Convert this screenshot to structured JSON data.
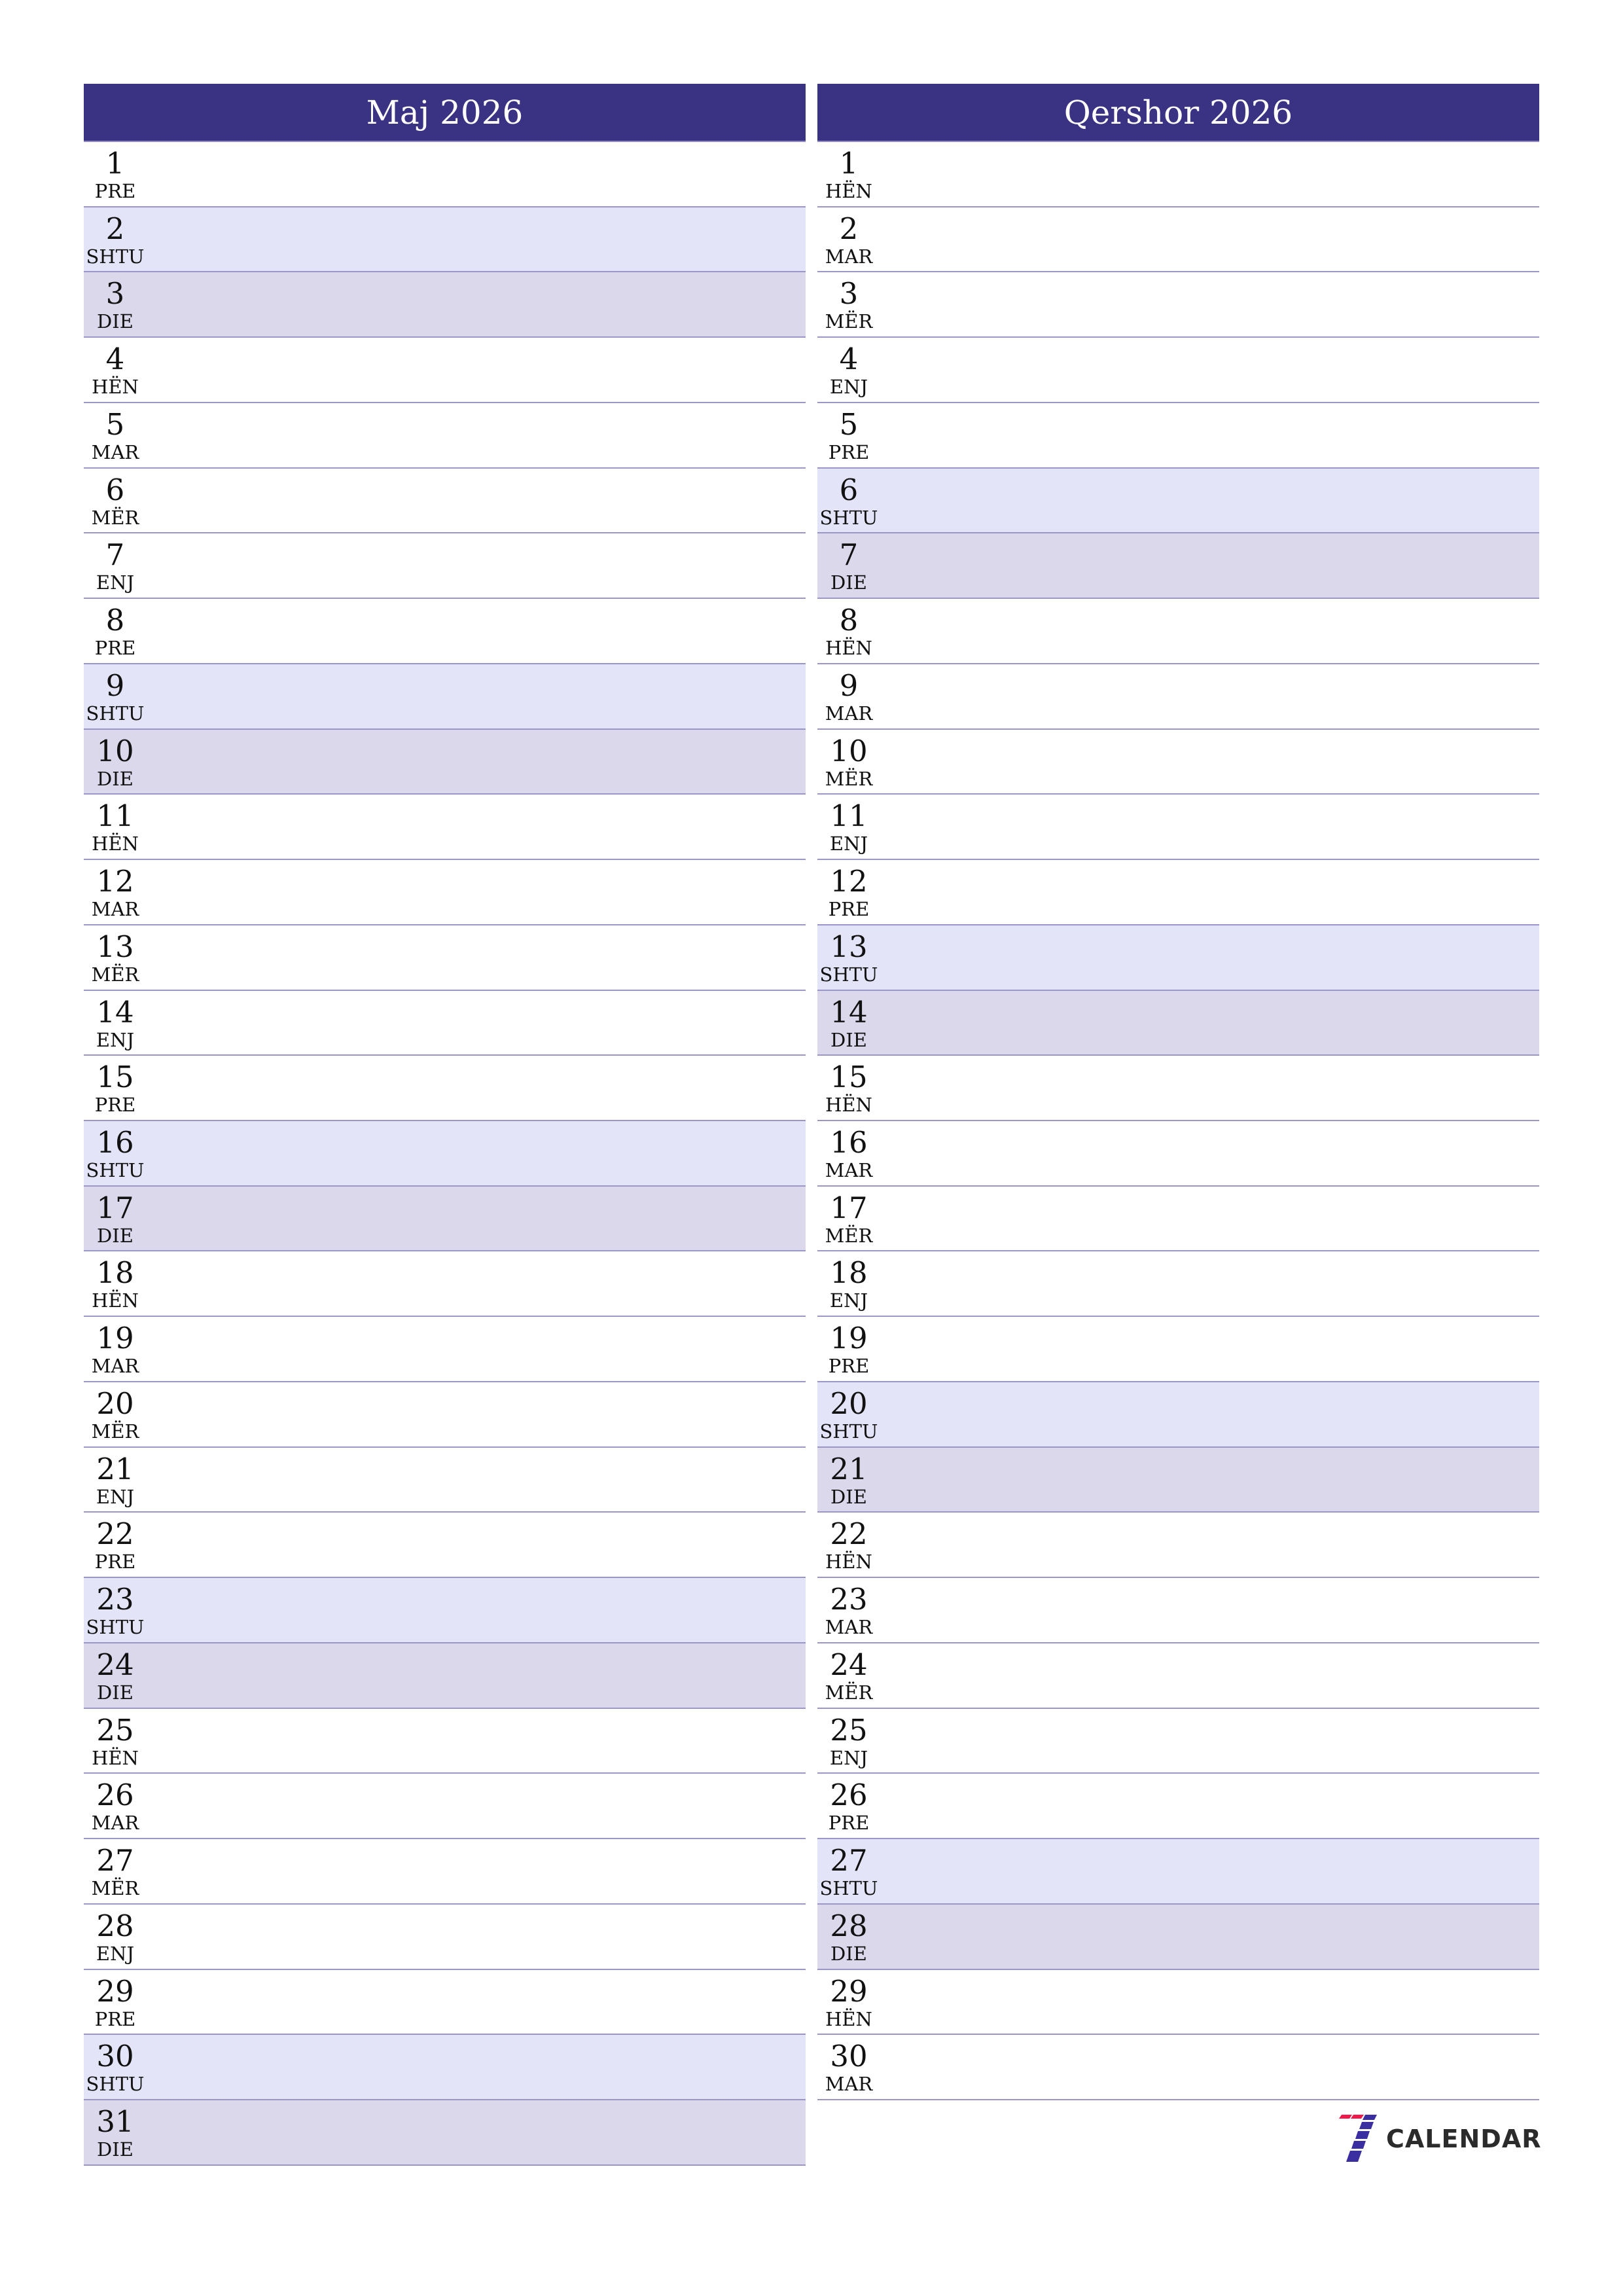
{
  "colors": {
    "header_bg": "#3a3282",
    "saturday_bg": "#e4e4f8",
    "sunday_bg": "#dcd8ec",
    "row_border": "#9a96c8",
    "logo_red": "#f0184a",
    "logo_blue": "#3a2ea0"
  },
  "months": [
    {
      "title": "Maj 2026",
      "days": [
        {
          "num": "1",
          "name": "PRE",
          "type": "weekday"
        },
        {
          "num": "2",
          "name": "SHTU",
          "type": "sat"
        },
        {
          "num": "3",
          "name": "DIE",
          "type": "sun"
        },
        {
          "num": "4",
          "name": "HËN",
          "type": "weekday"
        },
        {
          "num": "5",
          "name": "MAR",
          "type": "weekday"
        },
        {
          "num": "6",
          "name": "MËR",
          "type": "weekday"
        },
        {
          "num": "7",
          "name": "ENJ",
          "type": "weekday"
        },
        {
          "num": "8",
          "name": "PRE",
          "type": "weekday"
        },
        {
          "num": "9",
          "name": "SHTU",
          "type": "sat"
        },
        {
          "num": "10",
          "name": "DIE",
          "type": "sun"
        },
        {
          "num": "11",
          "name": "HËN",
          "type": "weekday"
        },
        {
          "num": "12",
          "name": "MAR",
          "type": "weekday"
        },
        {
          "num": "13",
          "name": "MËR",
          "type": "weekday"
        },
        {
          "num": "14",
          "name": "ENJ",
          "type": "weekday"
        },
        {
          "num": "15",
          "name": "PRE",
          "type": "weekday"
        },
        {
          "num": "16",
          "name": "SHTU",
          "type": "sat"
        },
        {
          "num": "17",
          "name": "DIE",
          "type": "sun"
        },
        {
          "num": "18",
          "name": "HËN",
          "type": "weekday"
        },
        {
          "num": "19",
          "name": "MAR",
          "type": "weekday"
        },
        {
          "num": "20",
          "name": "MËR",
          "type": "weekday"
        },
        {
          "num": "21",
          "name": "ENJ",
          "type": "weekday"
        },
        {
          "num": "22",
          "name": "PRE",
          "type": "weekday"
        },
        {
          "num": "23",
          "name": "SHTU",
          "type": "sat"
        },
        {
          "num": "24",
          "name": "DIE",
          "type": "sun"
        },
        {
          "num": "25",
          "name": "HËN",
          "type": "weekday"
        },
        {
          "num": "26",
          "name": "MAR",
          "type": "weekday"
        },
        {
          "num": "27",
          "name": "MËR",
          "type": "weekday"
        },
        {
          "num": "28",
          "name": "ENJ",
          "type": "weekday"
        },
        {
          "num": "29",
          "name": "PRE",
          "type": "weekday"
        },
        {
          "num": "30",
          "name": "SHTU",
          "type": "sat"
        },
        {
          "num": "31",
          "name": "DIE",
          "type": "sun"
        }
      ]
    },
    {
      "title": "Qershor 2026",
      "days": [
        {
          "num": "1",
          "name": "HËN",
          "type": "weekday"
        },
        {
          "num": "2",
          "name": "MAR",
          "type": "weekday"
        },
        {
          "num": "3",
          "name": "MËR",
          "type": "weekday"
        },
        {
          "num": "4",
          "name": "ENJ",
          "type": "weekday"
        },
        {
          "num": "5",
          "name": "PRE",
          "type": "weekday"
        },
        {
          "num": "6",
          "name": "SHTU",
          "type": "sat"
        },
        {
          "num": "7",
          "name": "DIE",
          "type": "sun"
        },
        {
          "num": "8",
          "name": "HËN",
          "type": "weekday"
        },
        {
          "num": "9",
          "name": "MAR",
          "type": "weekday"
        },
        {
          "num": "10",
          "name": "MËR",
          "type": "weekday"
        },
        {
          "num": "11",
          "name": "ENJ",
          "type": "weekday"
        },
        {
          "num": "12",
          "name": "PRE",
          "type": "weekday"
        },
        {
          "num": "13",
          "name": "SHTU",
          "type": "sat"
        },
        {
          "num": "14",
          "name": "DIE",
          "type": "sun"
        },
        {
          "num": "15",
          "name": "HËN",
          "type": "weekday"
        },
        {
          "num": "16",
          "name": "MAR",
          "type": "weekday"
        },
        {
          "num": "17",
          "name": "MËR",
          "type": "weekday"
        },
        {
          "num": "18",
          "name": "ENJ",
          "type": "weekday"
        },
        {
          "num": "19",
          "name": "PRE",
          "type": "weekday"
        },
        {
          "num": "20",
          "name": "SHTU",
          "type": "sat"
        },
        {
          "num": "21",
          "name": "DIE",
          "type": "sun"
        },
        {
          "num": "22",
          "name": "HËN",
          "type": "weekday"
        },
        {
          "num": "23",
          "name": "MAR",
          "type": "weekday"
        },
        {
          "num": "24",
          "name": "MËR",
          "type": "weekday"
        },
        {
          "num": "25",
          "name": "ENJ",
          "type": "weekday"
        },
        {
          "num": "26",
          "name": "PRE",
          "type": "weekday"
        },
        {
          "num": "27",
          "name": "SHTU",
          "type": "sat"
        },
        {
          "num": "28",
          "name": "DIE",
          "type": "sun"
        },
        {
          "num": "29",
          "name": "HËN",
          "type": "weekday"
        },
        {
          "num": "30",
          "name": "MAR",
          "type": "weekday"
        }
      ]
    }
  ],
  "logo": {
    "icon": "seven-calendar-logo-icon",
    "text": "CALENDAR"
  }
}
